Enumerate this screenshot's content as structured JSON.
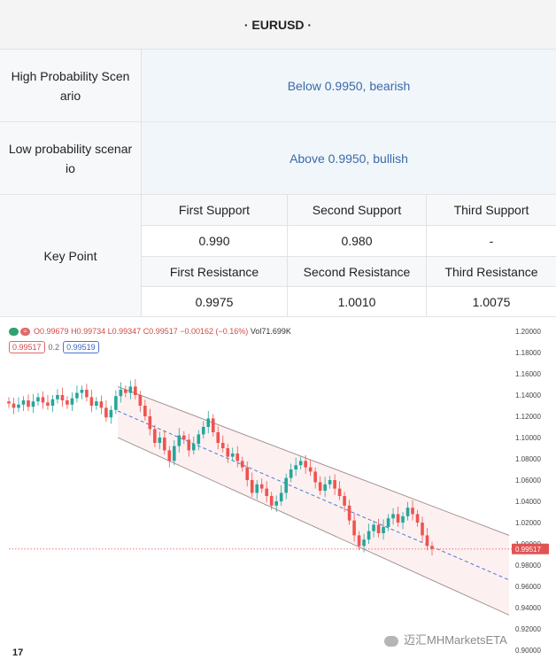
{
  "table": {
    "title": "· EURUSD ·",
    "high_label": "High Probability Scen ario",
    "high_value": "Below 0.9950,  bearish",
    "low_label": "Low probability scenar io",
    "low_value": "Above 0.9950,  bullish",
    "key_label": "Key Point",
    "headers1": [
      "First Support",
      "Second Support",
      "Third Support"
    ],
    "values1": [
      "0.990",
      "0.980",
      "-"
    ],
    "headers2": [
      "First Resistance",
      "Second Resistance",
      "Third Resistance"
    ],
    "values2": [
      "0.9975",
      "1.0010",
      "1.0075"
    ]
  },
  "chart": {
    "ohlc_o": "O0.99679",
    "ohlc_h": "H0.99734",
    "ohlc_l": "L0.99347",
    "ohlc_c": "C0.99517",
    "ohlc_chg": "−0.00162 (−0.16%)",
    "vol": "Vol71.699K",
    "bid": "0.99517",
    "spread": "0.2",
    "ask": "0.99519",
    "price_tag": "0.99517",
    "tv_logo": "17",
    "watermark": "迈汇MHMarketsETA",
    "colors": {
      "up": "#26a69a",
      "down": "#ef5350",
      "channel": "#fbe3e3",
      "midline": "#4a7adb"
    }
  },
  "chart_data": {
    "type": "candlestick",
    "title": "",
    "y_ticks": [
      "1.20000",
      "1.18000",
      "1.16000",
      "1.14000",
      "1.12000",
      "1.10000",
      "1.08000",
      "1.06000",
      "1.04000",
      "1.02000",
      "1.00000",
      "0.98000",
      "0.96000",
      "0.94000",
      "0.92000",
      "0.90000"
    ],
    "ylim": [
      0.9,
      1.2
    ],
    "close_path": [
      1.132,
      1.128,
      1.131,
      1.135,
      1.129,
      1.134,
      1.138,
      1.133,
      1.13,
      1.136,
      1.14,
      1.135,
      1.131,
      1.137,
      1.142,
      1.145,
      1.138,
      1.13,
      1.134,
      1.128,
      1.119,
      1.126,
      1.139,
      1.145,
      1.142,
      1.148,
      1.14,
      1.13,
      1.12,
      1.108,
      1.095,
      1.1,
      1.088,
      1.078,
      1.092,
      1.102,
      1.098,
      1.088,
      1.094,
      1.103,
      1.11,
      1.118,
      1.105,
      1.095,
      1.09,
      1.082,
      1.085,
      1.078,
      1.072,
      1.06,
      1.048,
      1.056,
      1.052,
      1.045,
      1.036,
      1.04,
      1.048,
      1.062,
      1.07,
      1.074,
      1.078,
      1.072,
      1.068,
      1.058,
      1.05,
      1.056,
      1.06,
      1.052,
      1.045,
      1.036,
      1.022,
      1.008,
      0.998,
      1.004,
      1.012,
      1.018,
      1.01,
      1.016,
      1.024,
      1.028,
      1.02,
      1.026,
      1.034,
      1.028,
      1.02,
      1.008,
      0.998,
      0.9952
    ],
    "last_price": 0.99517,
    "channel_upper": [
      [
        0,
        1.148
      ],
      [
        1,
        1.008
      ]
    ],
    "channel_lower": [
      [
        0,
        1.1
      ],
      [
        1,
        0.933
      ]
    ],
    "midline": [
      [
        0,
        1.125
      ],
      [
        1,
        0.966
      ]
    ]
  }
}
